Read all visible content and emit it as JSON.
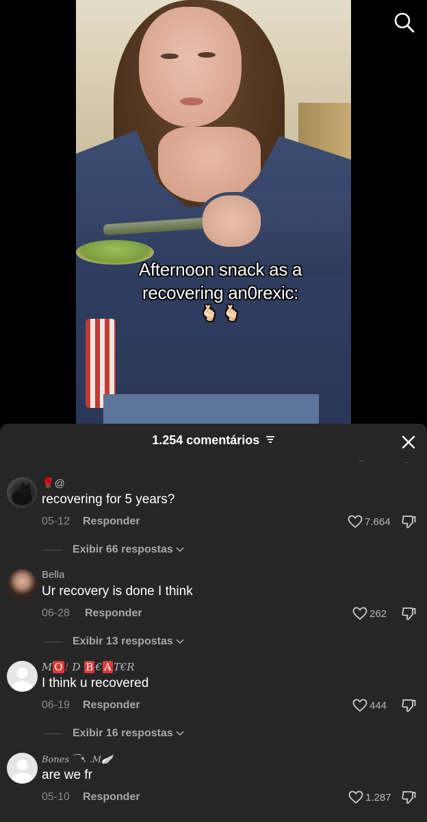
{
  "video": {
    "caption_line1": "Afternoon snack as a",
    "caption_line2": "recovering an0rexic:",
    "caption_emoji": "🫰🏻 🫰🏻"
  },
  "comments_panel": {
    "count_label": "1.254 comentários",
    "comments": [
      {
        "username": "🌹@",
        "text": "recovering for 5 years?",
        "date": "05-12",
        "reply_label": "Responder",
        "likes": "7.664",
        "view_replies": "Exibir 66 respostas"
      },
      {
        "username": "Bella",
        "text": "Ur recovery is done I think",
        "date": "06-28",
        "reply_label": "Responder",
        "likes": "262",
        "view_replies": "Exibir 13 respostas"
      },
      {
        "username": "M O ! D B€AT€R",
        "username_parts": [
          "M",
          "O",
          "!",
          "D",
          "B",
          "€",
          "A",
          "T€R"
        ],
        "text": "I think u recovered",
        "date": "06-19",
        "reply_label": "Responder",
        "likes": "444",
        "view_replies": "Exibir 16 respostas"
      },
      {
        "username": "Bones ⁀➷ .M🪽",
        "username_parts": [
          "Bones",
          "⁀➷ .M🪽"
        ],
        "text": "are we fr",
        "date": "05-10",
        "reply_label": "Responder",
        "likes": "1.287"
      }
    ]
  },
  "icons": {
    "search": "search-icon",
    "close": "close-icon",
    "sort": "sort-icon",
    "like": "heart-icon",
    "dislike": "thumbs-down-icon",
    "expand": "chevron-down-icon"
  }
}
